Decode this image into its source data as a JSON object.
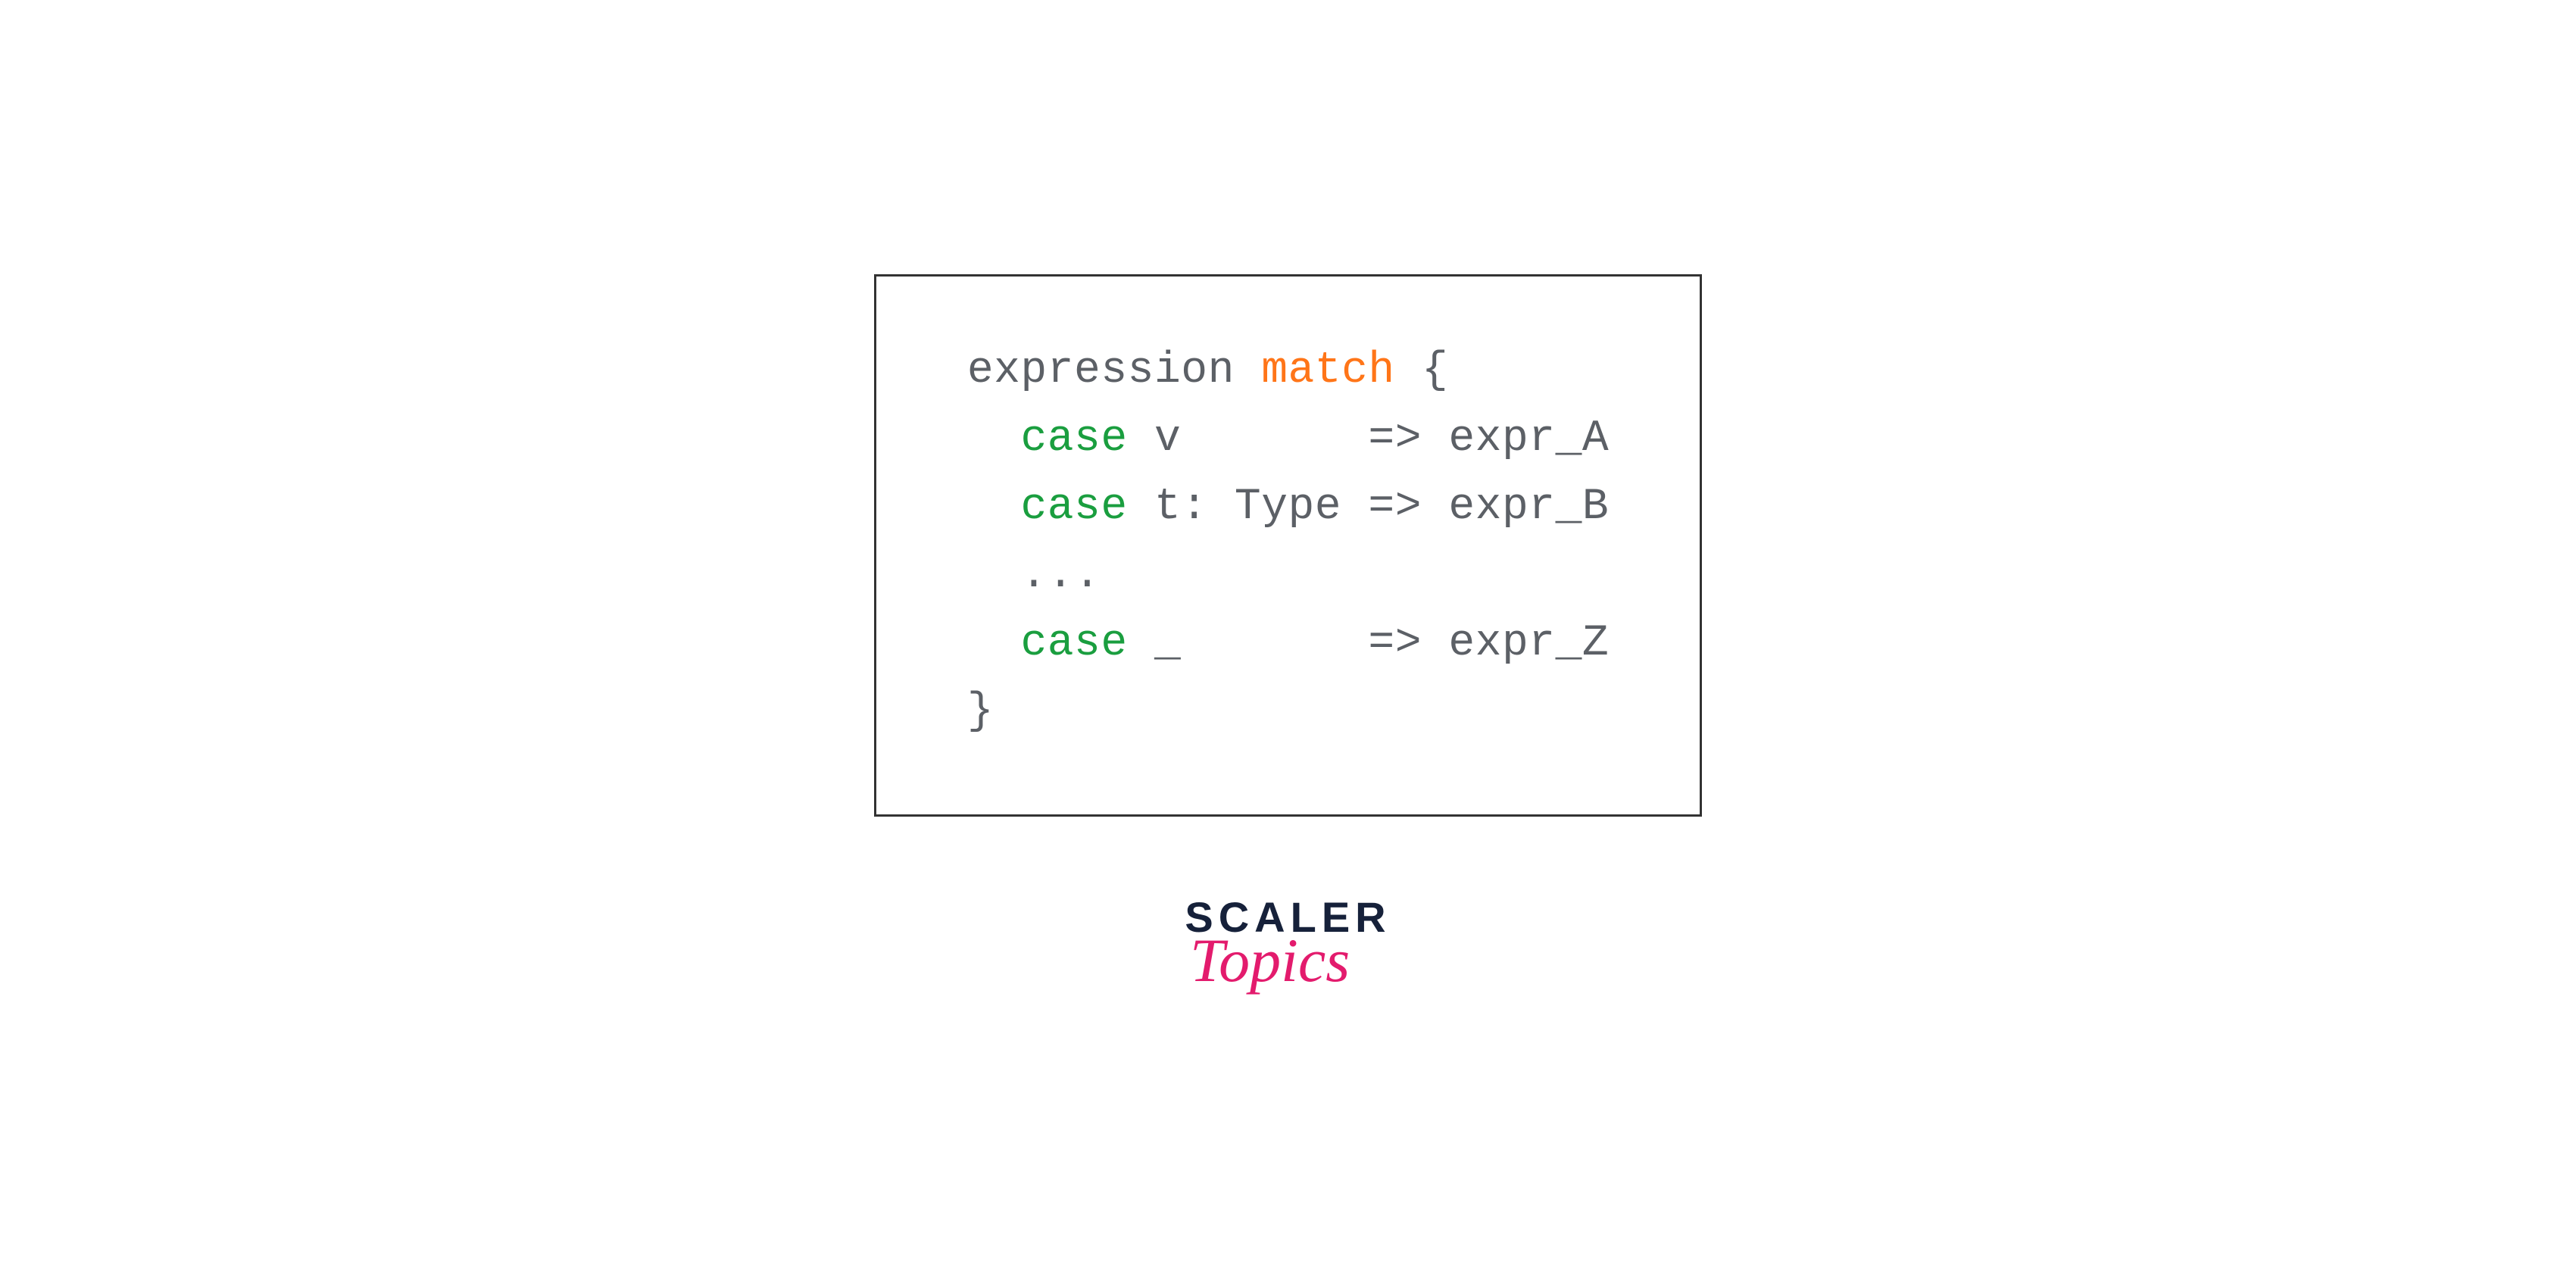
{
  "code": {
    "line1": {
      "expr": "expression ",
      "match": "match",
      "brace": " {"
    },
    "line2": {
      "indent": "  ",
      "case": "case",
      "rest": " v       => expr_A"
    },
    "line3": {
      "indent": "  ",
      "case": "case",
      "rest": " t: Type => expr_B"
    },
    "line4": {
      "indent": "  ",
      "dots": "..."
    },
    "line5": {
      "indent": "  ",
      "case": "case",
      "rest": " _       => expr_Z"
    },
    "line6": {
      "brace": "}"
    }
  },
  "logo": {
    "scaler": "SCALER",
    "topics": "Topics"
  }
}
